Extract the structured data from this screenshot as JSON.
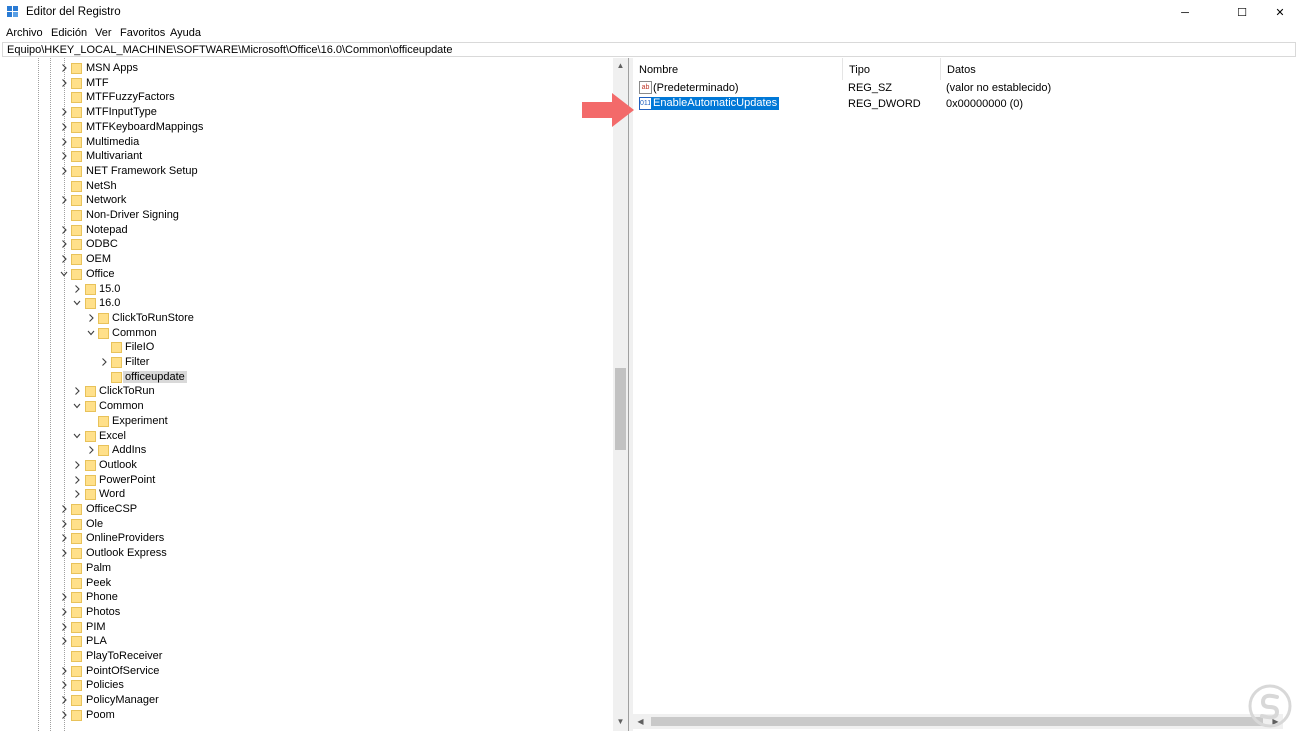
{
  "window": {
    "title": "Editor del Registro",
    "controls": {
      "minimize": "─",
      "maximize": "☐",
      "close": "✕"
    }
  },
  "menu": [
    "Archivo",
    "Edición",
    "Ver",
    "Favoritos",
    "Ayuda"
  ],
  "address": "Equipo\\HKEY_LOCAL_MACHINE\\SOFTWARE\\Microsoft\\Office\\16.0\\Common\\officeupdate",
  "tree": [
    {
      "label": "MSN Apps",
      "level": 0,
      "expander": "collapsed"
    },
    {
      "label": "MTF",
      "level": 0,
      "expander": "collapsed"
    },
    {
      "label": "MTFFuzzyFactors",
      "level": 0,
      "expander": "none"
    },
    {
      "label": "MTFInputType",
      "level": 0,
      "expander": "collapsed"
    },
    {
      "label": "MTFKeyboardMappings",
      "level": 0,
      "expander": "collapsed"
    },
    {
      "label": "Multimedia",
      "level": 0,
      "expander": "collapsed"
    },
    {
      "label": "Multivariant",
      "level": 0,
      "expander": "collapsed"
    },
    {
      "label": "NET Framework Setup",
      "level": 0,
      "expander": "collapsed"
    },
    {
      "label": "NetSh",
      "level": 0,
      "expander": "none"
    },
    {
      "label": "Network",
      "level": 0,
      "expander": "collapsed"
    },
    {
      "label": "Non-Driver Signing",
      "level": 0,
      "expander": "none"
    },
    {
      "label": "Notepad",
      "level": 0,
      "expander": "collapsed"
    },
    {
      "label": "ODBC",
      "level": 0,
      "expander": "collapsed"
    },
    {
      "label": "OEM",
      "level": 0,
      "expander": "collapsed"
    },
    {
      "label": "Office",
      "level": 0,
      "expander": "expanded"
    },
    {
      "label": "15.0",
      "level": 1,
      "expander": "collapsed"
    },
    {
      "label": "16.0",
      "level": 1,
      "expander": "expanded"
    },
    {
      "label": "ClickToRunStore",
      "level": 2,
      "expander": "collapsed"
    },
    {
      "label": "Common",
      "level": 2,
      "expander": "expanded"
    },
    {
      "label": "FileIO",
      "level": 3,
      "expander": "none"
    },
    {
      "label": "Filter",
      "level": 3,
      "expander": "collapsed"
    },
    {
      "label": "officeupdate",
      "level": 3,
      "expander": "none",
      "selected": true
    },
    {
      "label": "ClickToRun",
      "level": 1,
      "expander": "collapsed"
    },
    {
      "label": "Common",
      "level": 1,
      "expander": "expanded"
    },
    {
      "label": "Experiment",
      "level": 2,
      "expander": "none"
    },
    {
      "label": "Excel",
      "level": 1,
      "expander": "expanded"
    },
    {
      "label": "AddIns",
      "level": 2,
      "expander": "collapsed"
    },
    {
      "label": "Outlook",
      "level": 1,
      "expander": "collapsed"
    },
    {
      "label": "PowerPoint",
      "level": 1,
      "expander": "collapsed"
    },
    {
      "label": "Word",
      "level": 1,
      "expander": "collapsed"
    },
    {
      "label": "OfficeCSP",
      "level": 0,
      "expander": "collapsed"
    },
    {
      "label": "Ole",
      "level": 0,
      "expander": "collapsed"
    },
    {
      "label": "OnlineProviders",
      "level": 0,
      "expander": "collapsed"
    },
    {
      "label": "Outlook Express",
      "level": 0,
      "expander": "collapsed"
    },
    {
      "label": "Palm",
      "level": 0,
      "expander": "none"
    },
    {
      "label": "Peek",
      "level": 0,
      "expander": "none"
    },
    {
      "label": "Phone",
      "level": 0,
      "expander": "collapsed"
    },
    {
      "label": "Photos",
      "level": 0,
      "expander": "collapsed"
    },
    {
      "label": "PIM",
      "level": 0,
      "expander": "collapsed"
    },
    {
      "label": "PLA",
      "level": 0,
      "expander": "collapsed"
    },
    {
      "label": "PlayToReceiver",
      "level": 0,
      "expander": "none"
    },
    {
      "label": "PointOfService",
      "level": 0,
      "expander": "collapsed"
    },
    {
      "label": "Policies",
      "level": 0,
      "expander": "collapsed"
    },
    {
      "label": "PolicyManager",
      "level": 0,
      "expander": "collapsed"
    },
    {
      "label": "Poom",
      "level": 0,
      "expander": "collapsed"
    }
  ],
  "list": {
    "columns": [
      "Nombre",
      "Tipo",
      "Datos"
    ],
    "rows": [
      {
        "icon": "ab",
        "name": "(Predeterminado)",
        "type": "REG_SZ",
        "data": "(valor no establecido)",
        "selected": false
      },
      {
        "icon": "011",
        "name": "EnableAutomaticUpdates",
        "type": "REG_DWORD",
        "data": "0x00000000 (0)",
        "selected": true
      }
    ]
  },
  "colors": {
    "selection": "#0078d7",
    "folder": "#ffe08a",
    "arrow": "#f36a6a"
  }
}
